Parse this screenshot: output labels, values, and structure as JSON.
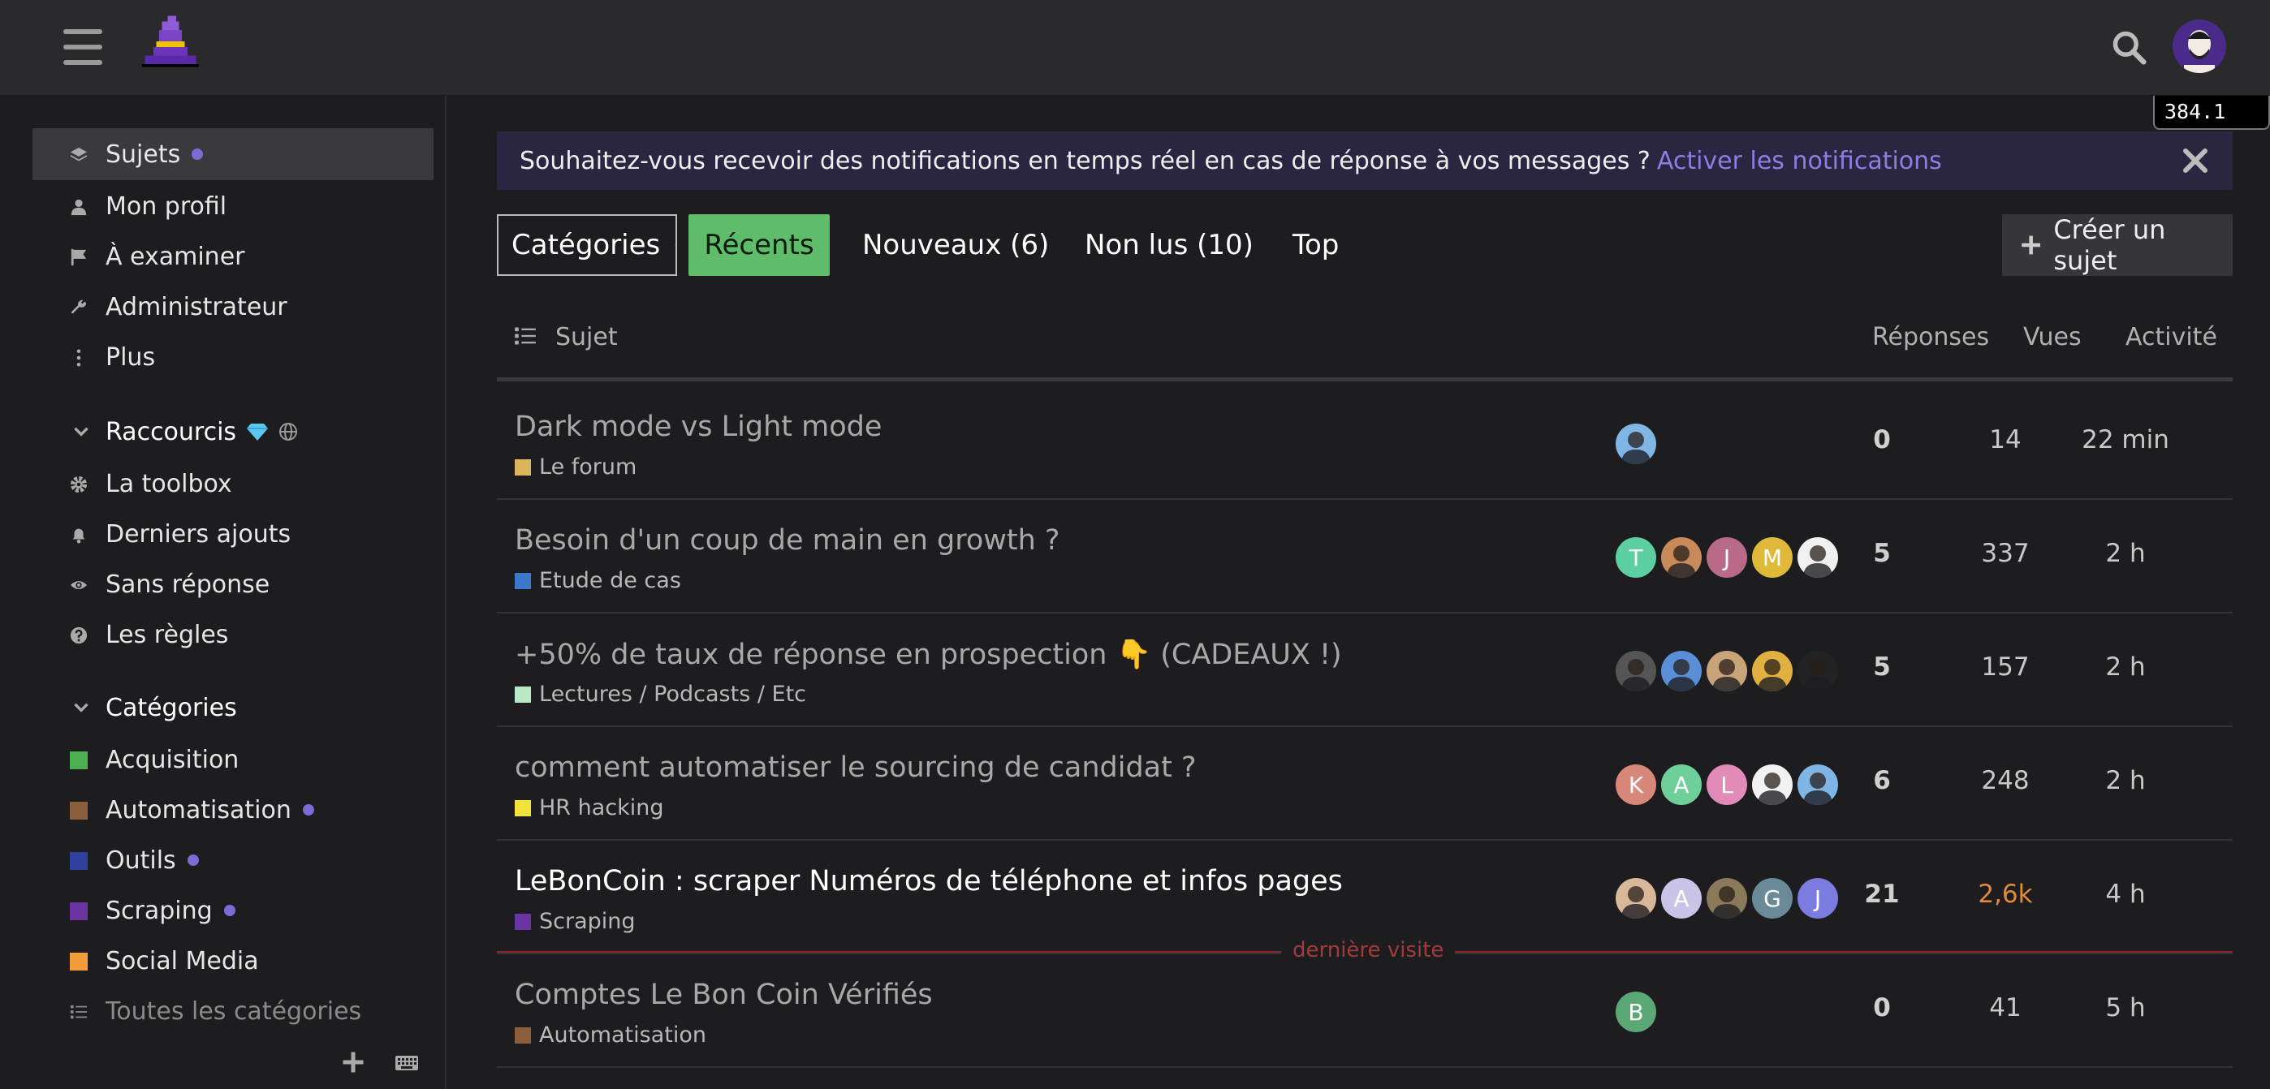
{
  "header": {
    "logo": "wizard-hat-logo",
    "timing": "384.1 ms"
  },
  "sidebar": {
    "items": [
      {
        "label": "Sujets",
        "icon": "layers-icon",
        "active": true,
        "dot": true
      },
      {
        "label": "Mon profil",
        "icon": "user-icon"
      },
      {
        "label": "À examiner",
        "icon": "flag-icon"
      },
      {
        "label": "Administrateur",
        "icon": "wrench-icon"
      },
      {
        "label": "Plus",
        "icon": "vertical-ellipsis-icon"
      }
    ],
    "shortcuts_title": "Raccourcis",
    "shortcuts": [
      {
        "label": "La toolbox",
        "icon": "cog-icon"
      },
      {
        "label": "Derniers ajouts",
        "icon": "bell-icon"
      },
      {
        "label": "Sans réponse",
        "icon": "eye-icon"
      },
      {
        "label": "Les règles",
        "icon": "question-circle-icon"
      }
    ],
    "categories_title": "Catégories",
    "categories": [
      {
        "label": "Acquisition",
        "color": "#4caf50"
      },
      {
        "label": "Automatisation",
        "color": "#8b5e3c",
        "dot": true
      },
      {
        "label": "Outils",
        "color": "#2f3f9e",
        "dot": true
      },
      {
        "label": "Scraping",
        "color": "#6a35a0",
        "dot": true
      },
      {
        "label": "Social Media",
        "color": "#f39c3c"
      }
    ],
    "all_categories": "Toutes les catégories"
  },
  "banner": {
    "text": "Souhaitez-vous recevoir des notifications en temps réel en cas de réponse à vos messages ?",
    "link": "Activer les notifications"
  },
  "navbar": {
    "categories": "Catégories",
    "recent": "Récents",
    "new": "Nouveaux (6)",
    "unread": "Non lus (10)",
    "top": "Top",
    "create": "Créer un sujet"
  },
  "table": {
    "col_topic": "Sujet",
    "col_replies": "Réponses",
    "col_views": "Vues",
    "col_activity": "Activité",
    "last_visit": "dernière visite",
    "rows": [
      {
        "title": "Dark mode vs Light mode",
        "category": "Le forum",
        "cat_color": "#d9b55b",
        "replies": "0",
        "views": "14",
        "activity": "22 min",
        "unread": false
      },
      {
        "title": "Besoin d'un coup de main en growth ?",
        "category": "Etude de cas",
        "cat_color": "#3a78c9",
        "replies": "5",
        "views": "337",
        "activity": "2 h",
        "unread": false
      },
      {
        "title": "+50% de taux de réponse en prospection 👇 (CADEAUX !)",
        "category": "Lectures / Podcasts / Etc",
        "cat_color": "#b8e8c4",
        "replies": "5",
        "views": "157",
        "activity": "2 h",
        "unread": false
      },
      {
        "title": "comment automatiser le sourcing de candidat ?",
        "category": "HR hacking",
        "cat_color": "#f2e43a",
        "replies": "6",
        "views": "248",
        "activity": "2 h",
        "unread": false
      },
      {
        "title": "LeBonCoin : scraper Numéros de téléphone et infos pages",
        "category": "Scraping",
        "cat_color": "#6a35a0",
        "replies": "21",
        "views": "2,6k",
        "activity": "4 h",
        "unread": true
      },
      {
        "title": "Comptes Le Bon Coin Vérifiés",
        "category": "Automatisation",
        "cat_color": "#8b5e3c",
        "replies": "0",
        "views": "41",
        "activity": "5 h",
        "unread": false
      }
    ],
    "posters": [
      [
        {
          "letter": "",
          "color": "#7fb6e6",
          "photo": true
        }
      ],
      [
        {
          "letter": "T",
          "color": "#5ccfa0"
        },
        {
          "letter": "",
          "color": "#c98a5a",
          "photo": true
        },
        {
          "letter": "J",
          "color": "#b86a86"
        },
        {
          "letter": "M",
          "color": "#e1b93a"
        },
        {
          "letter": "",
          "color": "#f0f0f0",
          "photo": true
        }
      ],
      [
        {
          "letter": "",
          "color": "#555",
          "photo": true
        },
        {
          "letter": "",
          "color": "#5a8fd8",
          "photo": true
        },
        {
          "letter": "",
          "color": "#c9a47a",
          "photo": true
        },
        {
          "letter": "",
          "color": "#e0b040",
          "photo": true
        },
        {
          "letter": "",
          "color": "#222",
          "photo": true
        }
      ],
      [
        {
          "letter": "K",
          "color": "#d8887a"
        },
        {
          "letter": "A",
          "color": "#6fcf9a"
        },
        {
          "letter": "L",
          "color": "#e28ab8"
        },
        {
          "letter": "",
          "color": "#f2f2f2",
          "photo": true
        },
        {
          "letter": "",
          "color": "#7fb6e6",
          "photo": true
        }
      ],
      [
        {
          "letter": "",
          "color": "#d9b89a",
          "photo": true
        },
        {
          "letter": "A",
          "color": "#c9c3e8"
        },
        {
          "letter": "",
          "color": "#8a7a5a",
          "photo": true
        },
        {
          "letter": "G",
          "color": "#6a8a9a"
        },
        {
          "letter": "J",
          "color": "#7b7be0"
        }
      ],
      [
        {
          "letter": "B",
          "color": "#5aa876"
        }
      ]
    ]
  }
}
